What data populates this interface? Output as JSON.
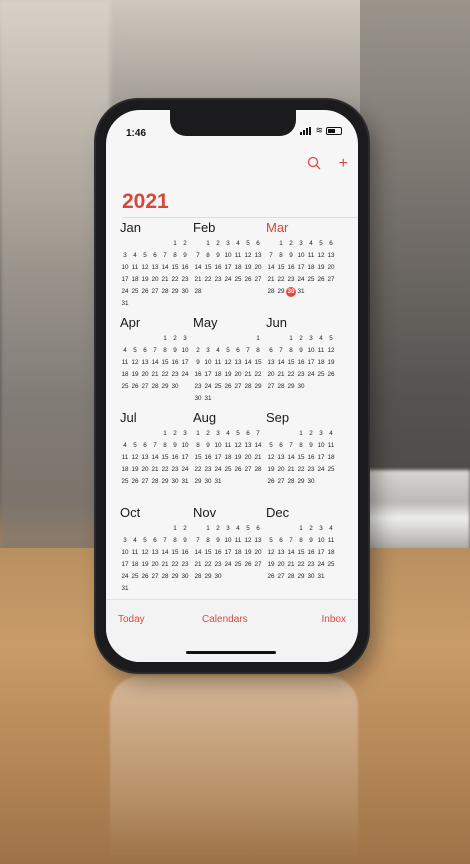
{
  "status": {
    "time": "1:46"
  },
  "toolbar": {
    "search_icon": "search-icon",
    "add": "+"
  },
  "year": "2021",
  "months": [
    {
      "name": "Jan",
      "offset": 5,
      "days": 31,
      "current": false
    },
    {
      "name": "Feb",
      "offset": 1,
      "days": 28,
      "current": false
    },
    {
      "name": "Mar",
      "offset": 1,
      "days": 31,
      "current": true,
      "today": 30
    },
    {
      "name": "Apr",
      "offset": 4,
      "days": 30,
      "current": false
    },
    {
      "name": "May",
      "offset": 6,
      "days": 31,
      "current": false
    },
    {
      "name": "Jun",
      "offset": 2,
      "days": 30,
      "current": false
    },
    {
      "name": "Jul",
      "offset": 4,
      "days": 31,
      "current": false
    },
    {
      "name": "Aug",
      "offset": 0,
      "days": 31,
      "current": false
    },
    {
      "name": "Sep",
      "offset": 3,
      "days": 30,
      "current": false
    },
    {
      "name": "Oct",
      "offset": 5,
      "days": 31,
      "current": false
    },
    {
      "name": "Nov",
      "offset": 1,
      "days": 30,
      "current": false
    },
    {
      "name": "Dec",
      "offset": 3,
      "days": 31,
      "current": false
    }
  ],
  "tabbar": {
    "today": "Today",
    "calendars": "Calendars",
    "inbox": "Inbox"
  },
  "colors": {
    "accent": "#e2483e",
    "year": "#d44838"
  }
}
